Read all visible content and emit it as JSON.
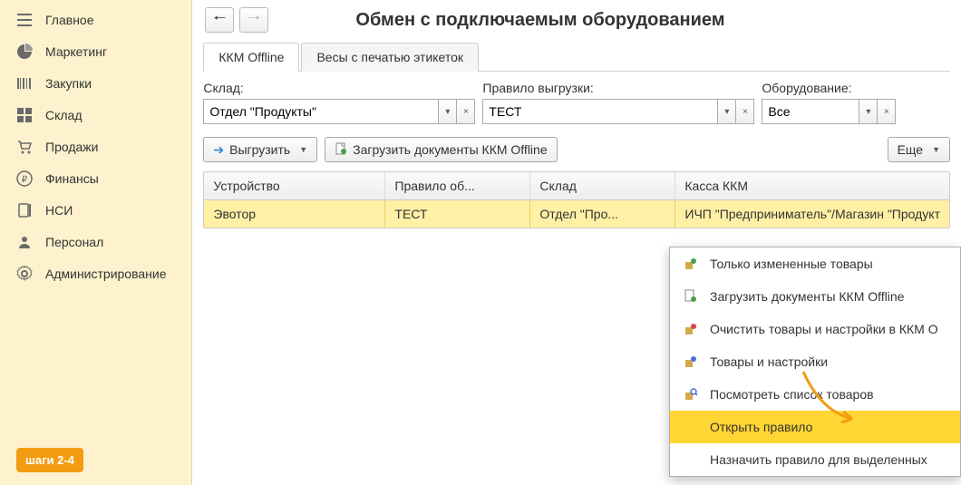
{
  "sidebar": {
    "items": [
      {
        "label": "Главное"
      },
      {
        "label": "Маркетинг"
      },
      {
        "label": "Закупки"
      },
      {
        "label": "Склад"
      },
      {
        "label": "Продажи"
      },
      {
        "label": "Финансы"
      },
      {
        "label": "НСИ"
      },
      {
        "label": "Персонал"
      },
      {
        "label": "Администрирование"
      }
    ],
    "badge": "шаги 2-4"
  },
  "header": {
    "title": "Обмен с подключаемым оборудованием"
  },
  "tabs": [
    {
      "label": "ККМ Offline",
      "active": true
    },
    {
      "label": "Весы с печатью этикеток",
      "active": false
    }
  ],
  "filters": {
    "warehouse": {
      "label": "Склад:",
      "value": "Отдел \"Продукты\""
    },
    "rule": {
      "label": "Правило выгрузки:",
      "value": "ТЕСТ"
    },
    "equipment": {
      "label": "Оборудование:",
      "value": "Все"
    }
  },
  "actions": {
    "export": "Выгрузить",
    "import": "Загрузить документы ККМ Offline",
    "more": "Еще"
  },
  "table": {
    "headers": {
      "c1": "Устройство",
      "c2": "Правило об...",
      "c3": "Склад",
      "c4": "Касса ККМ"
    },
    "rows": [
      {
        "c1": "Эвотор",
        "c2": "ТЕСТ",
        "c3": "Отдел \"Про...",
        "c4": "ИЧП \"Предприниматель\"/Магазин \"Продукт"
      }
    ]
  },
  "context_menu": {
    "items": [
      {
        "label": "Только измененные товары",
        "icon": "changed"
      },
      {
        "label": "Загрузить документы ККМ Offline",
        "icon": "upload"
      },
      {
        "label": "Очистить товары и настройки в ККМ O",
        "icon": "clear"
      },
      {
        "label": "Товары и настройки",
        "icon": "settings"
      },
      {
        "label": "Посмотреть список товаров",
        "icon": "view"
      },
      {
        "label": "Открыть правило",
        "icon": "",
        "highlight": true
      },
      {
        "label": "Назначить правило для выделенных",
        "icon": ""
      }
    ]
  }
}
